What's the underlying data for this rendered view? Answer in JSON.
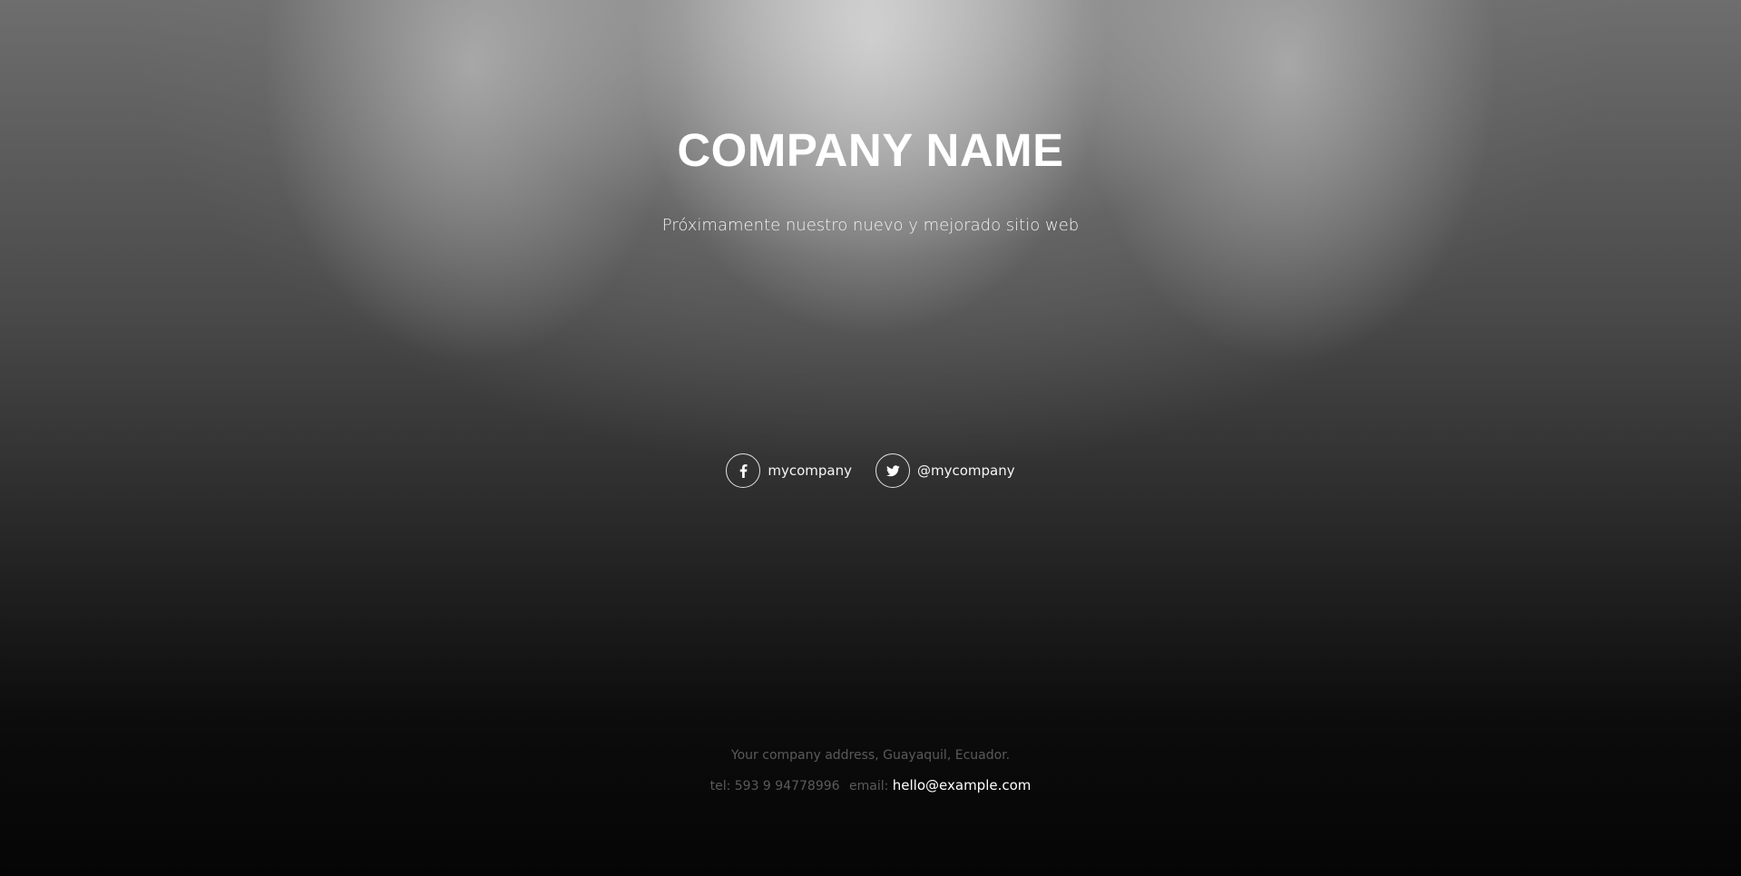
{
  "hero": {
    "title": "COMPANY NAME",
    "tagline": "Próximamente nuestro nuevo y mejorado sitio web"
  },
  "social": {
    "facebook": {
      "icon": "facebook-icon",
      "label": "mycompany"
    },
    "twitter": {
      "icon": "twitter-icon",
      "label": "@mycompany"
    }
  },
  "footer": {
    "address": "Your company address, Guayaquil, Ecuador.",
    "tel": "tel: 593 9 94778996",
    "email_prefix": "email:",
    "email": "hello@example.com"
  },
  "colors": {
    "text_primary": "#ffffff",
    "text_muted": "#5a5a5a",
    "background_dark": "#050505"
  }
}
